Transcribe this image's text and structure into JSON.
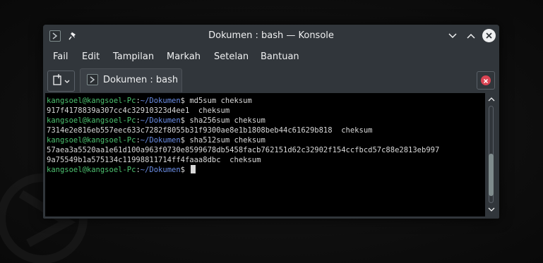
{
  "window": {
    "title": "Dokumen : bash — Konsole"
  },
  "menubar": {
    "items": [
      "Fail",
      "Edit",
      "Tampilan",
      "Markah",
      "Setelan",
      "Bantuan"
    ]
  },
  "tab": {
    "label": "Dokumen : bash"
  },
  "terminal": {
    "prompt_user": "kangsoel@kangsoel-Pc",
    "prompt_sep": ":",
    "prompt_path": "~/Dokumen",
    "prompt_end": "$ ",
    "lines": [
      {
        "type": "cmd",
        "text": "md5sum cheksum"
      },
      {
        "type": "out",
        "text": "917f4178839a307cc4c32910323d4ee1  cheksum"
      },
      {
        "type": "cmd",
        "text": "sha256sum cheksum"
      },
      {
        "type": "out",
        "text": "7314e2e816eb557eec633c7282f8055b31f9300ae8e1b1808beb44c61629b818  cheksum"
      },
      {
        "type": "cmd",
        "text": "sha512sum cheksum"
      },
      {
        "type": "out",
        "text": "57aea3a5520aa1e61d100a963f0730e8599678db5458facb762151d62c32902f154ccfbcd57c88e2813eb997"
      },
      {
        "type": "out",
        "text": "9a75549b1a575134c11998811714ff4faaa8dbc  cheksum"
      },
      {
        "type": "cmd",
        "text": ""
      }
    ]
  },
  "icons": {
    "app": "konsole-icon",
    "pin": "pin-icon",
    "minimize": "chevron-down-icon",
    "maximize": "chevron-up-icon",
    "close": "close-icon",
    "new_tab": "new-tab-icon",
    "close_tab": "close-tab-icon"
  },
  "colors": {
    "window_bg": "#31363b",
    "terminal_bg": "#000000",
    "prompt_user": "#4cc16f",
    "prompt_path": "#6b8ee6",
    "text": "#d8d8d8",
    "close_accent": "#da4453"
  }
}
